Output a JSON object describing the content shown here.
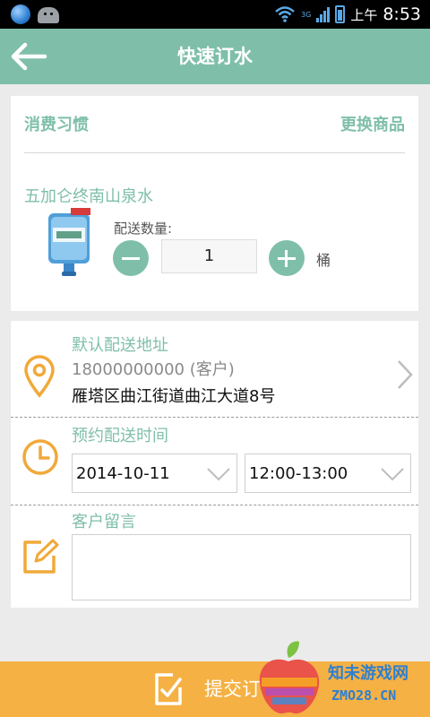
{
  "status_bar": {
    "network": "3G",
    "ampm": "上午",
    "time": "8:53"
  },
  "header": {
    "title": "快速订水"
  },
  "product_card": {
    "habit_label": "消费习惯",
    "switch_label": "更换商品",
    "product_name": "五加仑终南山泉水",
    "quantity_label": "配送数量:",
    "quantity": "1",
    "unit": "桶"
  },
  "delivery_card": {
    "address_title": "默认配送地址",
    "address_phone": "18000000000 (客户)",
    "address_street": "雁塔区曲江街道曲江大道8号",
    "time_title": "预约配送时间",
    "date_value": "2014-10-11",
    "time_value": "12:00-13:00",
    "message_title": "客户留言",
    "message_value": ""
  },
  "footer": {
    "submit_label": "提交订"
  },
  "watermark": {
    "name": "知未游戏网",
    "url": "ZMO28.CN"
  },
  "colors": {
    "accent": "#7fbfa9",
    "submit": "#f5b143",
    "icon": "#f0a93a"
  }
}
